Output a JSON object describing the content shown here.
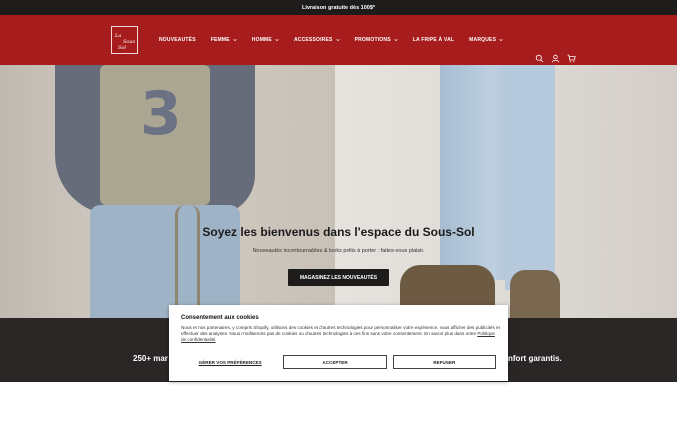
{
  "announcement": "Livraison gratuite dès 100$*",
  "logo_text": [
    "La",
    "Sous",
    "Sol"
  ],
  "nav": [
    {
      "label": "NOUVEAUTÉS",
      "has_menu": false
    },
    {
      "label": "FEMME",
      "has_menu": true
    },
    {
      "label": "HOMME",
      "has_menu": true
    },
    {
      "label": "ACCESSOIRES",
      "has_menu": true
    },
    {
      "label": "PROMOTIONS",
      "has_menu": true
    },
    {
      "label": "LA FRIPE À VAL",
      "has_menu": false
    },
    {
      "label": "MARQUES",
      "has_menu": true
    }
  ],
  "header_icons": [
    "search-icon",
    "account-icon",
    "cart-icon"
  ],
  "hero": {
    "title": "Soyez les bienvenus dans l'espace du Sous-Sol",
    "subtitle": "Nouveautés incontournables & looks prêts à porter : faites-vous plaisir.",
    "button": "MAGASINEZ LES NOUVEAUTÉS",
    "graphic_number": "3"
  },
  "band": {
    "left_text": "250+ mar",
    "right_text": "nfort garantis."
  },
  "cookie": {
    "title": "Consentement aux cookies",
    "text": "Nous et nos partenaires, y compris Shopify, utilisons des cookies et d'autres technologies pour personnaliser votre expérience, vous afficher des publicités et effectuer des analyses. Nous n'utiliserons pas de cookies ou d'autres technologies à ces fins sans votre consentement. En savoir plus dans notre",
    "policy_link": "Politique de confidentialité",
    "preferences": "GÉRER VOS PRÉFÉRENCES",
    "accept": "ACCEPTER",
    "refuse": "REFUSER"
  },
  "colors": {
    "header": "#a71d1d",
    "announcement": "#1e1b1b",
    "band": "#2a2626"
  }
}
